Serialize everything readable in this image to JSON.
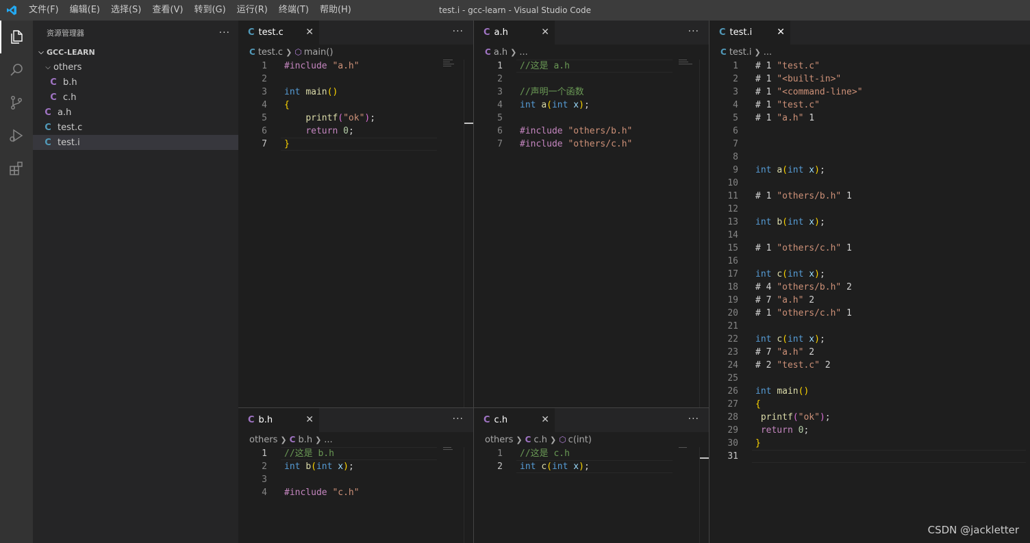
{
  "window": {
    "title": "test.i - gcc-learn - Visual Studio Code",
    "menu": [
      "文件(F)",
      "编辑(E)",
      "选择(S)",
      "查看(V)",
      "转到(G)",
      "运行(R)",
      "终端(T)",
      "帮助(H)"
    ]
  },
  "activity_bar": [
    "explorer-icon",
    "search-icon",
    "source-control-icon",
    "run-debug-icon",
    "extensions-icon"
  ],
  "sidebar": {
    "header": "资源管理器",
    "more": "···",
    "root": "GCC-LEARN",
    "items": [
      {
        "label": "others",
        "kind": "folder"
      },
      {
        "label": "b.h",
        "kind": "file",
        "icon": "C"
      },
      {
        "label": "c.h",
        "kind": "file",
        "icon": "C"
      },
      {
        "label": "a.h",
        "kind": "file",
        "icon": "C"
      },
      {
        "label": "test.c",
        "kind": "file",
        "icon": "C"
      },
      {
        "label": "test.i",
        "kind": "file",
        "icon": "C"
      }
    ]
  },
  "editors": {
    "test_c": {
      "tab": "test.c",
      "icon": "C",
      "breadcrumb": [
        "test.c",
        "main()"
      ],
      "lines": [
        "1",
        "2",
        "3",
        "4",
        "5",
        "6",
        "7"
      ]
    },
    "a_h": {
      "tab": "a.h",
      "icon": "C",
      "breadcrumb": [
        "a.h",
        "..."
      ],
      "lines": [
        "1",
        "2",
        "3",
        "4",
        "5",
        "6",
        "7"
      ]
    },
    "b_h": {
      "tab": "b.h",
      "icon": "C",
      "breadcrumb": [
        "others",
        "b.h",
        "..."
      ],
      "lines": [
        "1",
        "2",
        "3",
        "4"
      ]
    },
    "c_h": {
      "tab": "c.h",
      "icon": "C",
      "breadcrumb": [
        "others",
        "c.h",
        "c(int)"
      ],
      "lines": [
        "1",
        "2"
      ]
    },
    "test_i": {
      "tab": "test.i",
      "icon": "C",
      "breadcrumb": [
        "test.i",
        "..."
      ],
      "lines": [
        "1",
        "2",
        "3",
        "4",
        "5",
        "6",
        "7",
        "8",
        "9",
        "10",
        "11",
        "12",
        "13",
        "14",
        "15",
        "16",
        "17",
        "18",
        "19",
        "20",
        "21",
        "22",
        "23",
        "24",
        "25",
        "26",
        "27",
        "28",
        "29",
        "30",
        "31"
      ]
    }
  },
  "close_glyph": "✕",
  "more_glyph": "···",
  "watermark": "CSDN @jackletter",
  "colors": {
    "keyword": "#569cd6",
    "string": "#ce9178",
    "function": "#dcdcaa",
    "variable": "#9cdcfe",
    "comment": "#6a9955",
    "preprocessor": "#c586c0",
    "number": "#b5cea8",
    "bracket": "#ffd700",
    "accent": "#007acc"
  }
}
